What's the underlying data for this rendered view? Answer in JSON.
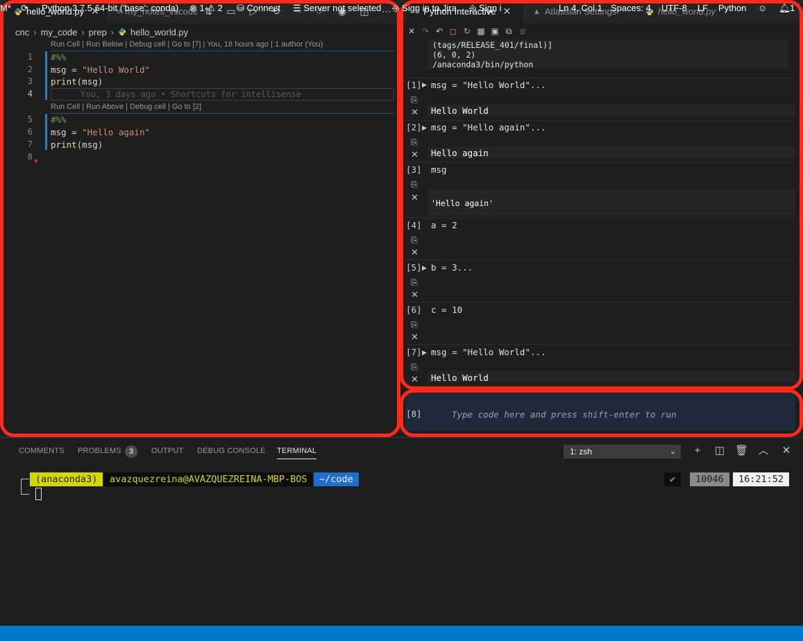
{
  "editor": {
    "tabs": [
      {
        "label": "hello_world.py",
        "active": true
      },
      {
        "label": "my_notes_vscode",
        "active": false
      }
    ],
    "breadcrumb": [
      "cnc",
      "my_code",
      "prep",
      "hello_world.py"
    ],
    "codelens1": "Run Cell | Run Below | Debug cell | Go to [7] | You, 18 hours ago | 1 author (You)",
    "codelens2": "Run Cell | Run Above | Debug cell | Go to [2]",
    "line_numbers": [
      "1",
      "2",
      "3",
      "4",
      "5",
      "6",
      "7",
      "8"
    ],
    "lines": {
      "l1": "#%%",
      "l2_var": "msg",
      "l2_op": " = ",
      "l2_str": "\"Hello World\"",
      "l3_fn": "print",
      "l3_rest": "(msg)",
      "l5": "#%%",
      "l6_var": "msg",
      "l6_op": " = ",
      "l6_str": "\"Hello again\"",
      "l7_fn": "print",
      "l7_rest": "(msg)"
    },
    "blame": "You, 3 days ago • Shortcuts for intellisense"
  },
  "interactive": {
    "tabs": [
      {
        "label": "Python Interactive",
        "active": true
      },
      {
        "label": "Atlassian Settings",
        "active": false
      },
      {
        "label": "hello_world.py",
        "active": false
      }
    ],
    "sysinfo": [
      "(tags/RELEASE_401/final)]",
      "(6, 0, 2)",
      "/anaconda3/bin/python"
    ],
    "cells": [
      {
        "no": "[1]",
        "code": "msg = \"Hello World\"...",
        "output": "Hello World"
      },
      {
        "no": "[2]",
        "code": "msg = \"Hello again\"...",
        "output": "Hello again"
      },
      {
        "no": "[3]",
        "code": "msg",
        "output": "'Hello again'"
      },
      {
        "no": "[4]",
        "code": "a = 2",
        "output": ""
      },
      {
        "no": "[5]",
        "code": "b = 3...",
        "output": ""
      },
      {
        "no": "[6]",
        "code": "c = 10",
        "output": ""
      },
      {
        "no": "[7]",
        "code": "msg = \"Hello World\"...",
        "output": "Hello World"
      }
    ],
    "input_no": "[8]",
    "input_placeholder": "Type code here and press shift-enter to run"
  },
  "panel": {
    "tabs": [
      "COMMENTS",
      "PROBLEMS",
      "OUTPUT",
      "DEBUG CONSOLE",
      "TERMINAL"
    ],
    "problems_count": "3",
    "terminal_select": "1: zsh",
    "prompt": {
      "env": "(anaconda3)",
      "user_host": "avazquezreina@AVAZQUEZREINA-MBP-BOS",
      "path": "~/code",
      "check": "✔",
      "history": "10046",
      "time": "16:21:52"
    }
  },
  "statusbar": {
    "left_marker": "M*",
    "python": "Python 3.7.5 64-bit ('base': conda)",
    "errors": "1",
    "warnings": "2",
    "connect": "Connect",
    "server": "Server not selected",
    "jira": "Sign in to Jira",
    "sign": "Sign i",
    "position": "Ln 4, Col 1",
    "spaces": "Spaces: 4",
    "encoding": "UTF-8",
    "eol": "LF",
    "language": "Python"
  },
  "colors": {
    "accent": "#007acc",
    "highlight": "#ff2a1a",
    "string": "#ce9178",
    "comment": "#6a9955"
  }
}
